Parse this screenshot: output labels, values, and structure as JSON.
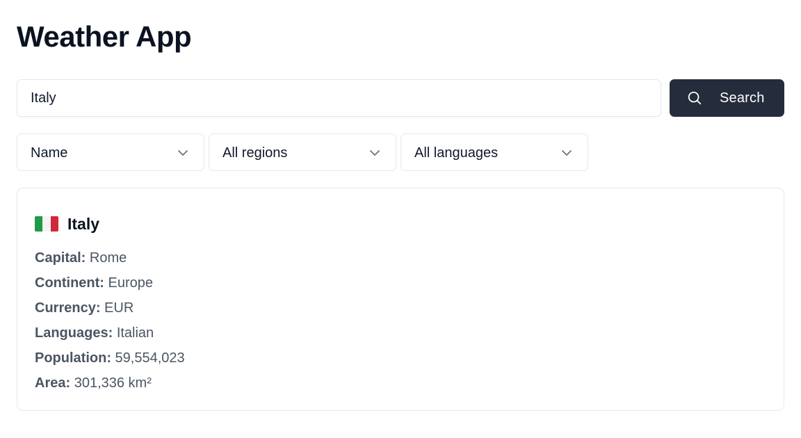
{
  "app": {
    "title": "Weather App"
  },
  "search": {
    "value": "Italy",
    "button_label": "Search",
    "button_icon": "search-icon"
  },
  "filters": {
    "sort": {
      "selected": "Name",
      "icon": "chevron-down-icon"
    },
    "region": {
      "selected": "All regions",
      "icon": "chevron-down-icon"
    },
    "language": {
      "selected": "All languages",
      "icon": "chevron-down-icon"
    }
  },
  "result": {
    "flag_icon": "italy-flag-icon",
    "name": "Italy",
    "details": [
      {
        "label": "Capital:",
        "value": "Rome"
      },
      {
        "label": "Continent:",
        "value": "Europe"
      },
      {
        "label": "Currency:",
        "value": "EUR"
      },
      {
        "label": "Languages:",
        "value": "Italian"
      },
      {
        "label": "Population:",
        "value": "59,554,023"
      },
      {
        "label": "Area:",
        "value": "301,336 km²"
      }
    ]
  },
  "colors": {
    "accent_button": "#252c3c",
    "border": "#e2e8f0",
    "text_muted": "#4b5563"
  }
}
